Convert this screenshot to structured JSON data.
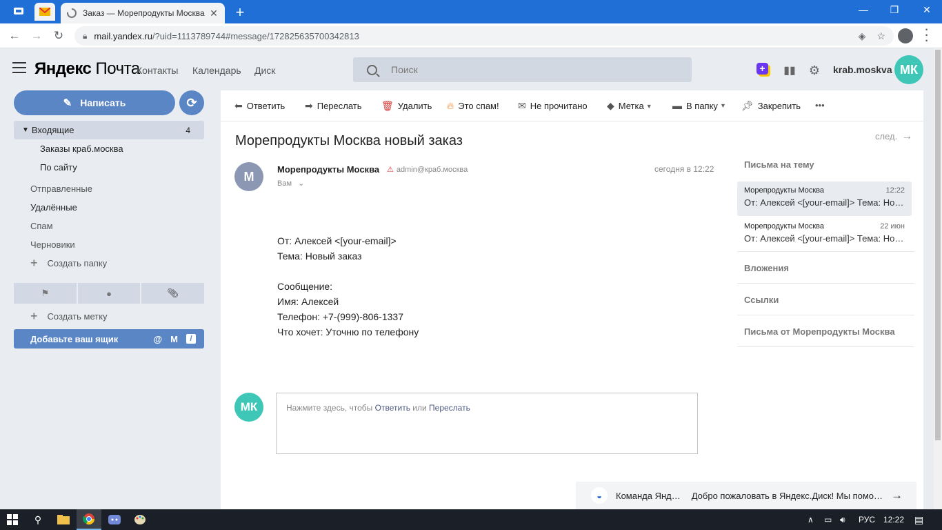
{
  "browser": {
    "tab_title": "Заказ — Морепродукты Москва",
    "tab_close": "✕",
    "newtab": "+",
    "url_host": "mail.yandex.ru",
    "url_path": "/?uid=1113789744#message/172825635700342813",
    "window_controls": [
      "—",
      "❐",
      "✕"
    ]
  },
  "header": {
    "logo_1": "Яндекс",
    "logo_2": " Почта",
    "nav": [
      "Контакты",
      "Календарь",
      "Диск"
    ],
    "search_placeholder": "Поиск",
    "username": "krab.moskva",
    "avatar_initials": "МК",
    "plus_icon": "+"
  },
  "sidebar": {
    "compose_label": "Написать",
    "folders": [
      {
        "label": "Входящие",
        "count": "4"
      },
      {
        "label": "Заказы краб.москва"
      },
      {
        "label": "По сайту"
      },
      {
        "label": "Отправленные"
      },
      {
        "label": "Удалённые"
      },
      {
        "label": "Спам"
      },
      {
        "label": "Черновики"
      }
    ],
    "create_folder": "Создать папку",
    "create_label": "Создать метку",
    "add_box": "Добавьте ваш ящик"
  },
  "toolbar": {
    "reply": "Ответить",
    "forward": "Переслать",
    "delete": "Удалить",
    "spam": "Это спам!",
    "unread": "Не прочитано",
    "label": "Метка",
    "to_folder": "В папку",
    "pin": "Закрепить",
    "more": "•••"
  },
  "message": {
    "subject": "Морепродукты Москва новый заказ",
    "next_label": "след.",
    "sender_initial": "М",
    "sender_name": "Морепродукты Москва",
    "sender_email": "admin@краб.москва",
    "to": "Вам",
    "date": "сегодня в 12:22",
    "body": [
      "От: Алексей <[your-email]>",
      "Тема: Новый заказ",
      "",
      "Сообщение:",
      "Имя: Алексей",
      "Телефон: +7-(999)-806-1337",
      "Что хочет: Уточню по телефону"
    ]
  },
  "reply": {
    "avatar_initials": "МК",
    "prefix": "Нажмите здесь, чтобы ",
    "reply_link": "Ответить",
    "middle": " или ",
    "forward_link": "Переслать"
  },
  "side_panel": {
    "thread_heading": "Письма на тему",
    "threads": [
      {
        "from": "Морепродукты Москва",
        "time": "12:22",
        "snippet": "От: Алексей <[your-email]> Тема: Новый заказ"
      },
      {
        "from": "Морепродукты Москва",
        "time": "22 июн",
        "snippet": "От: Алексей <[your-email]> Тема: Новый заказ"
      }
    ],
    "attachments": "Вложения",
    "links": "Ссылки",
    "from_sender": "Письма от Морепродукты Москва"
  },
  "notification": {
    "from": "Команда Янд…",
    "text": "Добро пожаловать в Яндекс.Диск! Мы помо…"
  },
  "taskbar": {
    "lang": "РУС",
    "time": "12:22"
  }
}
